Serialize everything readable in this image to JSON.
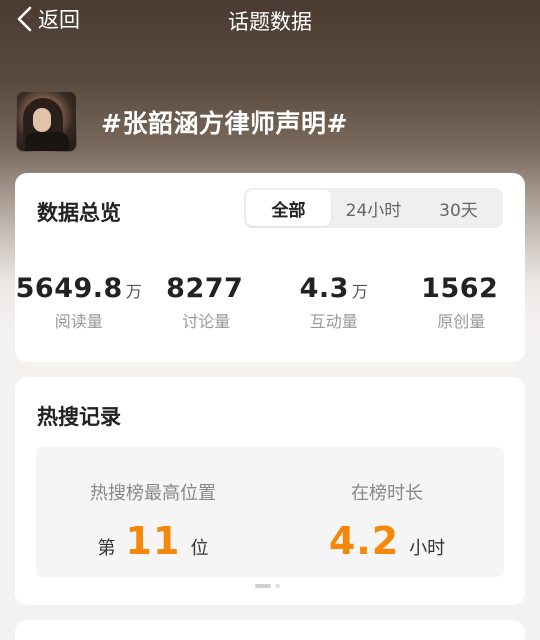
{
  "nav": {
    "back_label": "返回",
    "title": "话题数据"
  },
  "topic": {
    "title": "#张韶涵方律师声明#"
  },
  "overview": {
    "title": "数据总览",
    "tabs": [
      {
        "label": "全部",
        "active": true
      },
      {
        "label": "24小时",
        "active": false
      },
      {
        "label": "30天",
        "active": false
      }
    ],
    "stats": [
      {
        "value": "5649.8",
        "unit": "万",
        "label": "阅读量"
      },
      {
        "value": "8277",
        "unit": "",
        "label": "讨论量"
      },
      {
        "value": "4.3",
        "unit": "万",
        "label": "互动量"
      },
      {
        "value": "1562",
        "unit": "",
        "label": "原创量"
      }
    ]
  },
  "hot_search": {
    "title": "热搜记录",
    "peak_label": "热搜榜最高位置",
    "peak_prefix": "第",
    "peak_value": "11",
    "peak_suffix": "位",
    "duration_label": "在榜时长",
    "duration_value": "4.2",
    "duration_unit": "小时",
    "page_indicator": {
      "current": 1,
      "total": 2
    }
  },
  "colors": {
    "accent": "#f5870a",
    "header_dark": "#4a3b32",
    "background": "#f4f2f1"
  },
  "icons": {
    "back": "chevron-left-icon"
  }
}
